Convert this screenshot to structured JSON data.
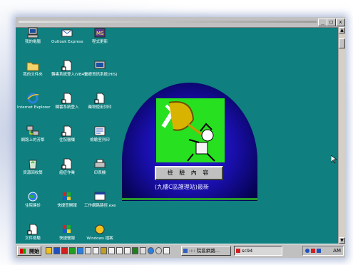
{
  "desktop": {
    "icons": [
      {
        "label": "我的電腦",
        "icon": "my-computer-icon"
      },
      {
        "label": "Outlook Express",
        "icon": "outlook-express-icon"
      },
      {
        "label": "程式更新",
        "icon": "program-update-icon"
      },
      {
        "label": "我的文件夾",
        "icon": "my-documents-icon"
      },
      {
        "label": "轉書系統登入(VB4)",
        "icon": "shortcut-icon"
      },
      {
        "label": "醫療資訊系統(HIS)",
        "icon": "shortcut-icon"
      },
      {
        "label": "Internet Explorer",
        "icon": "internet-explorer-icon"
      },
      {
        "label": "轉書系統登入",
        "icon": "shortcut-icon"
      },
      {
        "label": "藥物使用列印",
        "icon": "shortcut-icon"
      },
      {
        "label": "網路上的芳鄰",
        "icon": "network-neighborhood-icon"
      },
      {
        "label": "住院醫囑",
        "icon": "shortcut-icon"
      },
      {
        "label": "檢驗室列印",
        "icon": "shortcut-icon"
      },
      {
        "label": "資源回收筒",
        "icon": "recycle-bin-icon"
      },
      {
        "label": "癌症作業",
        "icon": "shortcut-icon"
      },
      {
        "label": "印表機",
        "icon": "shortcut-icon"
      },
      {
        "label": "住院健診",
        "icon": "shortcut-icon"
      },
      {
        "label": "快捷查開報",
        "icon": "shortcut-icon"
      },
      {
        "label": "工作網路路徑.exe",
        "icon": "shortcut-icon"
      },
      {
        "label": "文件檢驗",
        "icon": "shortcut-icon"
      },
      {
        "label": "快捷醫報",
        "icon": "shortcut-icon"
      },
      {
        "label": "Windows 檔案",
        "icon": "shortcut-icon"
      }
    ]
  },
  "splash": {
    "button_label": "檢 驗 內 容",
    "caption": "(九樓C區護理站)最新"
  },
  "taskbar": {
    "start_label": "開始",
    "tasks": [
      {
        "label": ":::: 院區網路..."
      },
      {
        "label": "sc94"
      }
    ],
    "clock": "AM"
  },
  "colors": {
    "desktop": "#0f7f7f",
    "splash_dome": "#1a0fae",
    "splash_panel": "#27e01f",
    "taskbar": "#c0c0c0"
  }
}
